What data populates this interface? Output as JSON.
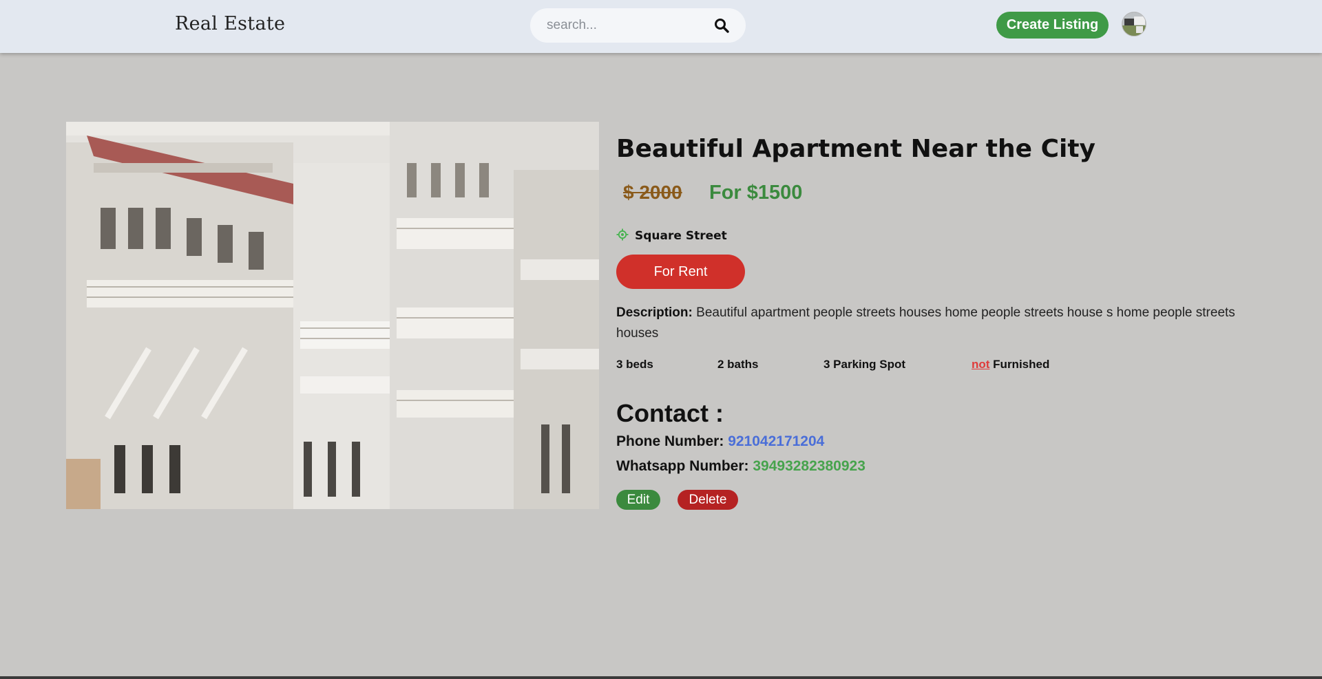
{
  "header": {
    "brand": "Real Estate",
    "search_placeholder": "search...",
    "search_icon": "search-icon",
    "create_listing_label": "Create Listing",
    "avatar": "user-avatar"
  },
  "listing": {
    "title": "Beautiful Apartment Near the City",
    "regular_price": "$ 2000",
    "discount_price": "For $1500",
    "address_icon": "location-icon",
    "address": "Square Street",
    "type_label": "For Rent",
    "description_label": "Description:",
    "description_text": "Beautiful apartment people streets houses home people streets house s home people streets houses",
    "features": {
      "beds": "3 beds",
      "baths": "2 baths",
      "parking": "3 Parking Spot",
      "furnished_not": "not",
      "furnished": "Furnished"
    },
    "contact": {
      "heading": "Contact :",
      "phone_label": "Phone Number:",
      "phone_value": "921042171204",
      "whatsapp_label": "Whatsapp Number:",
      "whatsapp_value": "39493282380923"
    },
    "actions": {
      "edit_label": "Edit",
      "delete_label": "Delete"
    }
  },
  "colors": {
    "page_bg": "#c8c7c5",
    "navbar_bg": "#e3e8f0",
    "green": "#3f9a47",
    "red": "#d0302a",
    "phone_blue": "#4a6ed8"
  }
}
